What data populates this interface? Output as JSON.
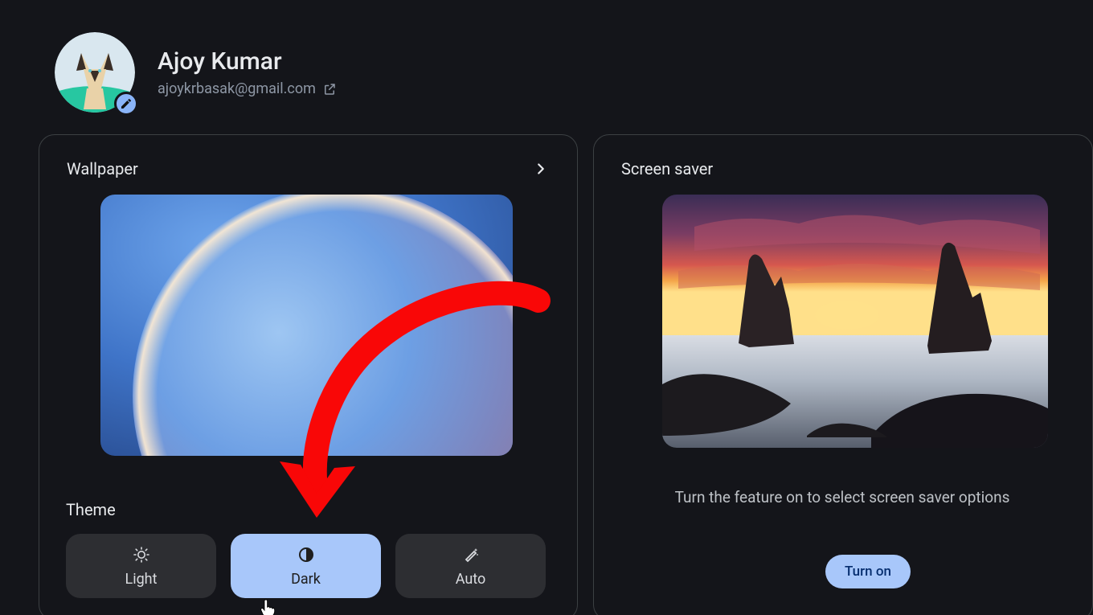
{
  "profile": {
    "name": "Ajoy Kumar",
    "email": "ajoykrbasak@gmail.com"
  },
  "wallpaper": {
    "title": "Wallpaper"
  },
  "theme": {
    "label": "Theme",
    "options": [
      "Light",
      "Dark",
      "Auto"
    ],
    "selected": "Dark"
  },
  "screensaver": {
    "title": "Screen saver",
    "hint": "Turn the feature on to select screen saver options",
    "button": "Turn on"
  },
  "annotation": {
    "arrow_target": "theme-option-dark"
  }
}
